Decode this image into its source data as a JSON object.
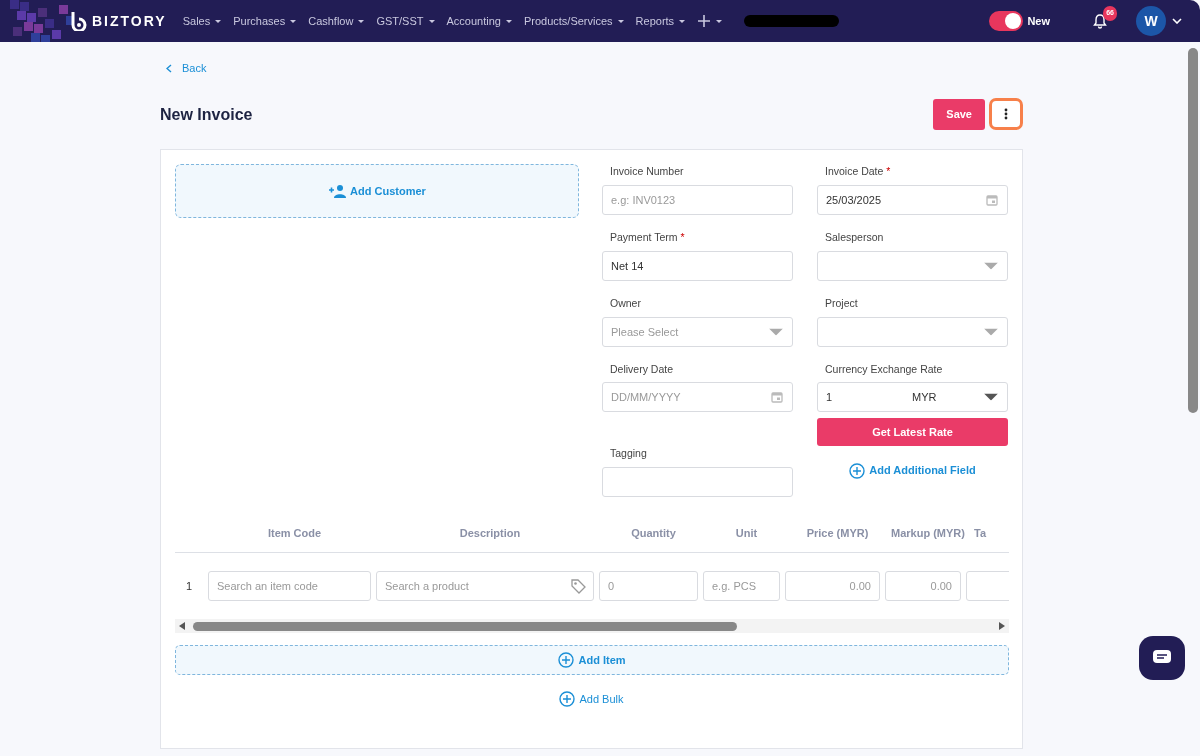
{
  "nav": {
    "brand": "BIZTORY",
    "menus": [
      {
        "label": "Sales"
      },
      {
        "label": "Purchases"
      },
      {
        "label": "Cashflow"
      },
      {
        "label": "GST/SST"
      },
      {
        "label": "Accounting"
      },
      {
        "label": "Products/Services"
      },
      {
        "label": "Reports"
      }
    ],
    "toggle": {
      "label": "New",
      "on": true
    },
    "notifications": {
      "count": "66"
    },
    "avatar": "W"
  },
  "required_mark": "*",
  "back": "Back",
  "title": "New Invoice",
  "save": "Save",
  "customer": "Add Customer",
  "fields": [
    {
      "kind": "text",
      "label": "Invoice Number",
      "required": false,
      "placeholder": "e.g: INV0123"
    },
    {
      "kind": "date",
      "label": "Invoice Date",
      "required": true,
      "value": "25/03/2025"
    },
    {
      "kind": "text",
      "label": "Payment Term",
      "required": true,
      "value": "Net 14"
    },
    {
      "kind": "select",
      "label": "Salesperson",
      "required": false
    },
    {
      "kind": "select",
      "label": "Owner",
      "required": false,
      "placeholder": "Please Select"
    },
    {
      "kind": "select",
      "label": "Project",
      "required": false
    },
    {
      "kind": "date",
      "label": "Delivery Date",
      "required": false,
      "placeholder": "DD/MM/YYYY"
    },
    {
      "kind": "currency",
      "label": "Currency Exchange Rate",
      "required": false,
      "value": "1",
      "currency": "MYR"
    },
    {
      "kind": "text",
      "label": "Tagging",
      "required": false
    }
  ],
  "rate_button": "Get Latest Rate",
  "additional_field": "Add Additional Field",
  "table": {
    "columns": [
      "Item Code",
      "Description",
      "Quantity",
      "Unit",
      "Price (MYR)",
      "Markup (MYR)",
      "Ta"
    ],
    "rows": [
      {
        "number": "1",
        "cells": [
          {
            "kind": "text",
            "placeholder": "Search an item code"
          },
          {
            "kind": "product",
            "placeholder": "Search a product"
          },
          {
            "kind": "text",
            "placeholder": "0"
          },
          {
            "kind": "text",
            "placeholder": "e.g. PCS"
          },
          {
            "kind": "number",
            "placeholder": "0.00"
          },
          {
            "kind": "number",
            "placeholder": "0.00"
          },
          {
            "kind": "text"
          }
        ]
      }
    ]
  },
  "add_item": "Add Item",
  "add_bulk": "Add Bulk"
}
